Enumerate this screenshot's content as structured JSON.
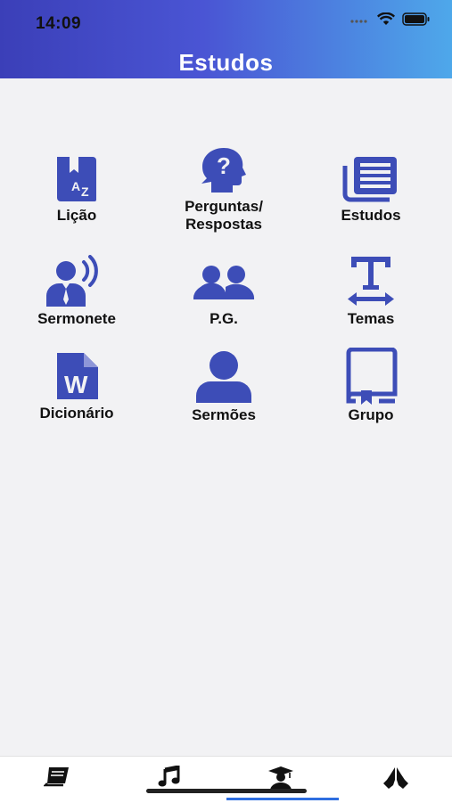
{
  "status_bar": {
    "time": "14:09"
  },
  "header": {
    "title": "Estudos"
  },
  "menu": {
    "licao": "Lição",
    "perguntas_line1": "Perguntas/",
    "perguntas_line2": "Respostas",
    "estudos": "Estudos",
    "sermonete": "Sermonete",
    "pg": "P.G.",
    "temas": "Temas",
    "dicionario": "Dicionário",
    "sermoes": "Sermões",
    "grupo": "Grupo"
  },
  "icons": {
    "licao": "book-az-icon",
    "perguntas": "head-question-icon",
    "estudos": "newspaper-stack-icon",
    "sermonete": "speaker-person-icon",
    "pg": "group-people-icon",
    "temas": "text-size-icon",
    "dicionario": "word-document-icon",
    "sermoes": "user-icon",
    "grupo": "bookmark-book-icon"
  },
  "tab_bar": {
    "tabs": [
      "book-icon",
      "music-note-icon",
      "graduate-icon",
      "praying-hands-icon"
    ],
    "active_tab": "graduate-icon"
  },
  "colors": {
    "accent": "#3d4db7",
    "header_start": "#3b3fb8",
    "header_end": "#4ea8ea",
    "active_tab_underline": "#2e6ee0"
  }
}
